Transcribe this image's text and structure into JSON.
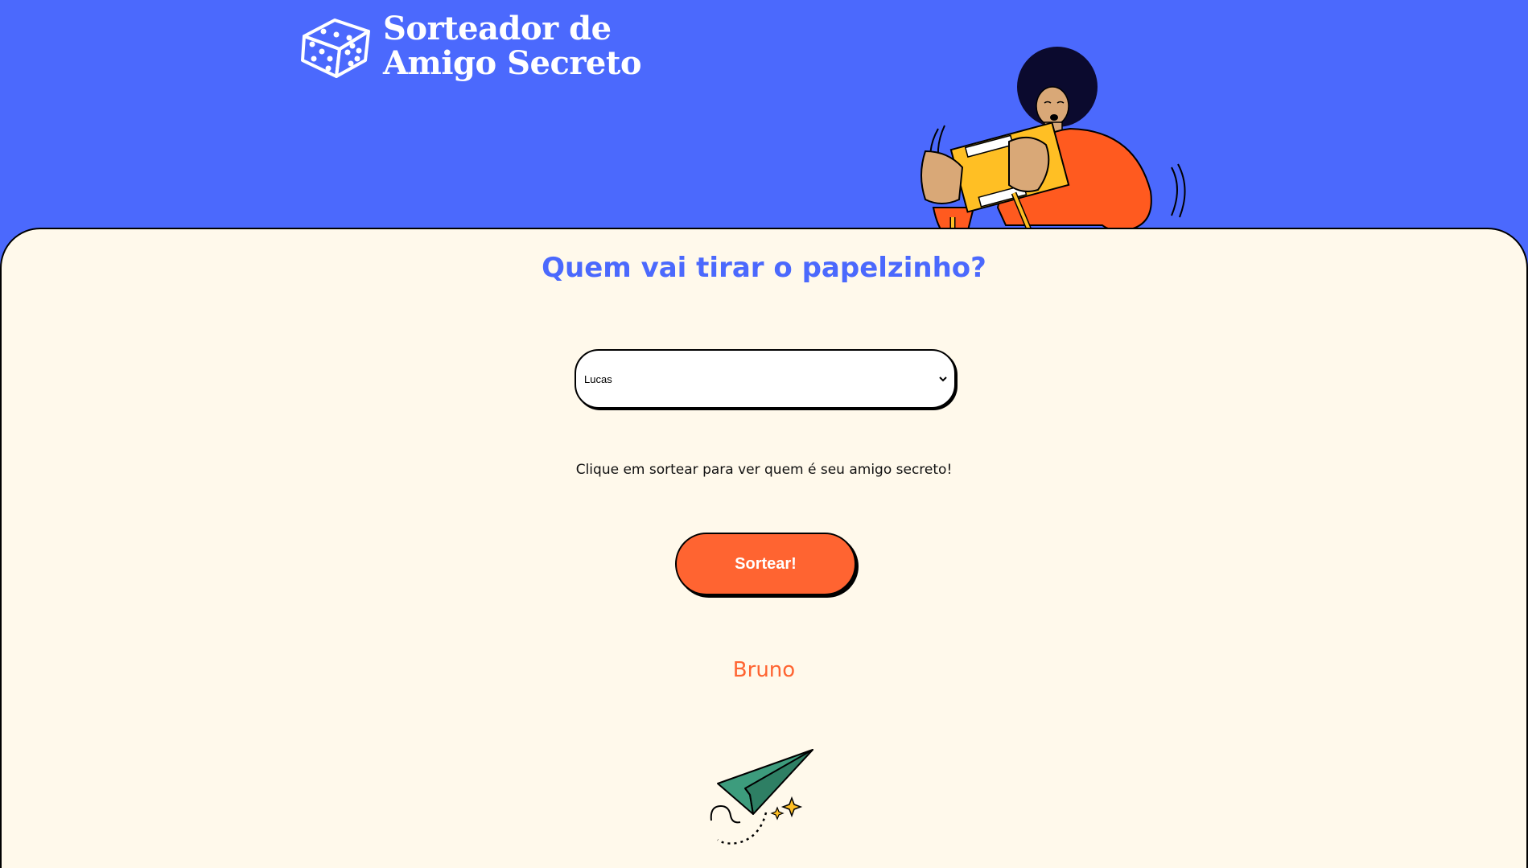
{
  "header": {
    "logo_line1": "Sorteador de",
    "logo_line2": "Amigo Secreto",
    "logo_icon": "dice-icon"
  },
  "main": {
    "title": "Quem vai tirar o papelzinho?",
    "select": {
      "selected": "Lucas"
    },
    "hint": "Clique em sortear para ver quem é seu amigo secreto!",
    "draw_button_label": "Sortear!",
    "result_name": "Bruno"
  },
  "colors": {
    "background": "#4b69fd",
    "card": "#fff9eb",
    "accent": "#ff6431",
    "title": "#4b69fd",
    "plane": "#3d9c7d"
  }
}
